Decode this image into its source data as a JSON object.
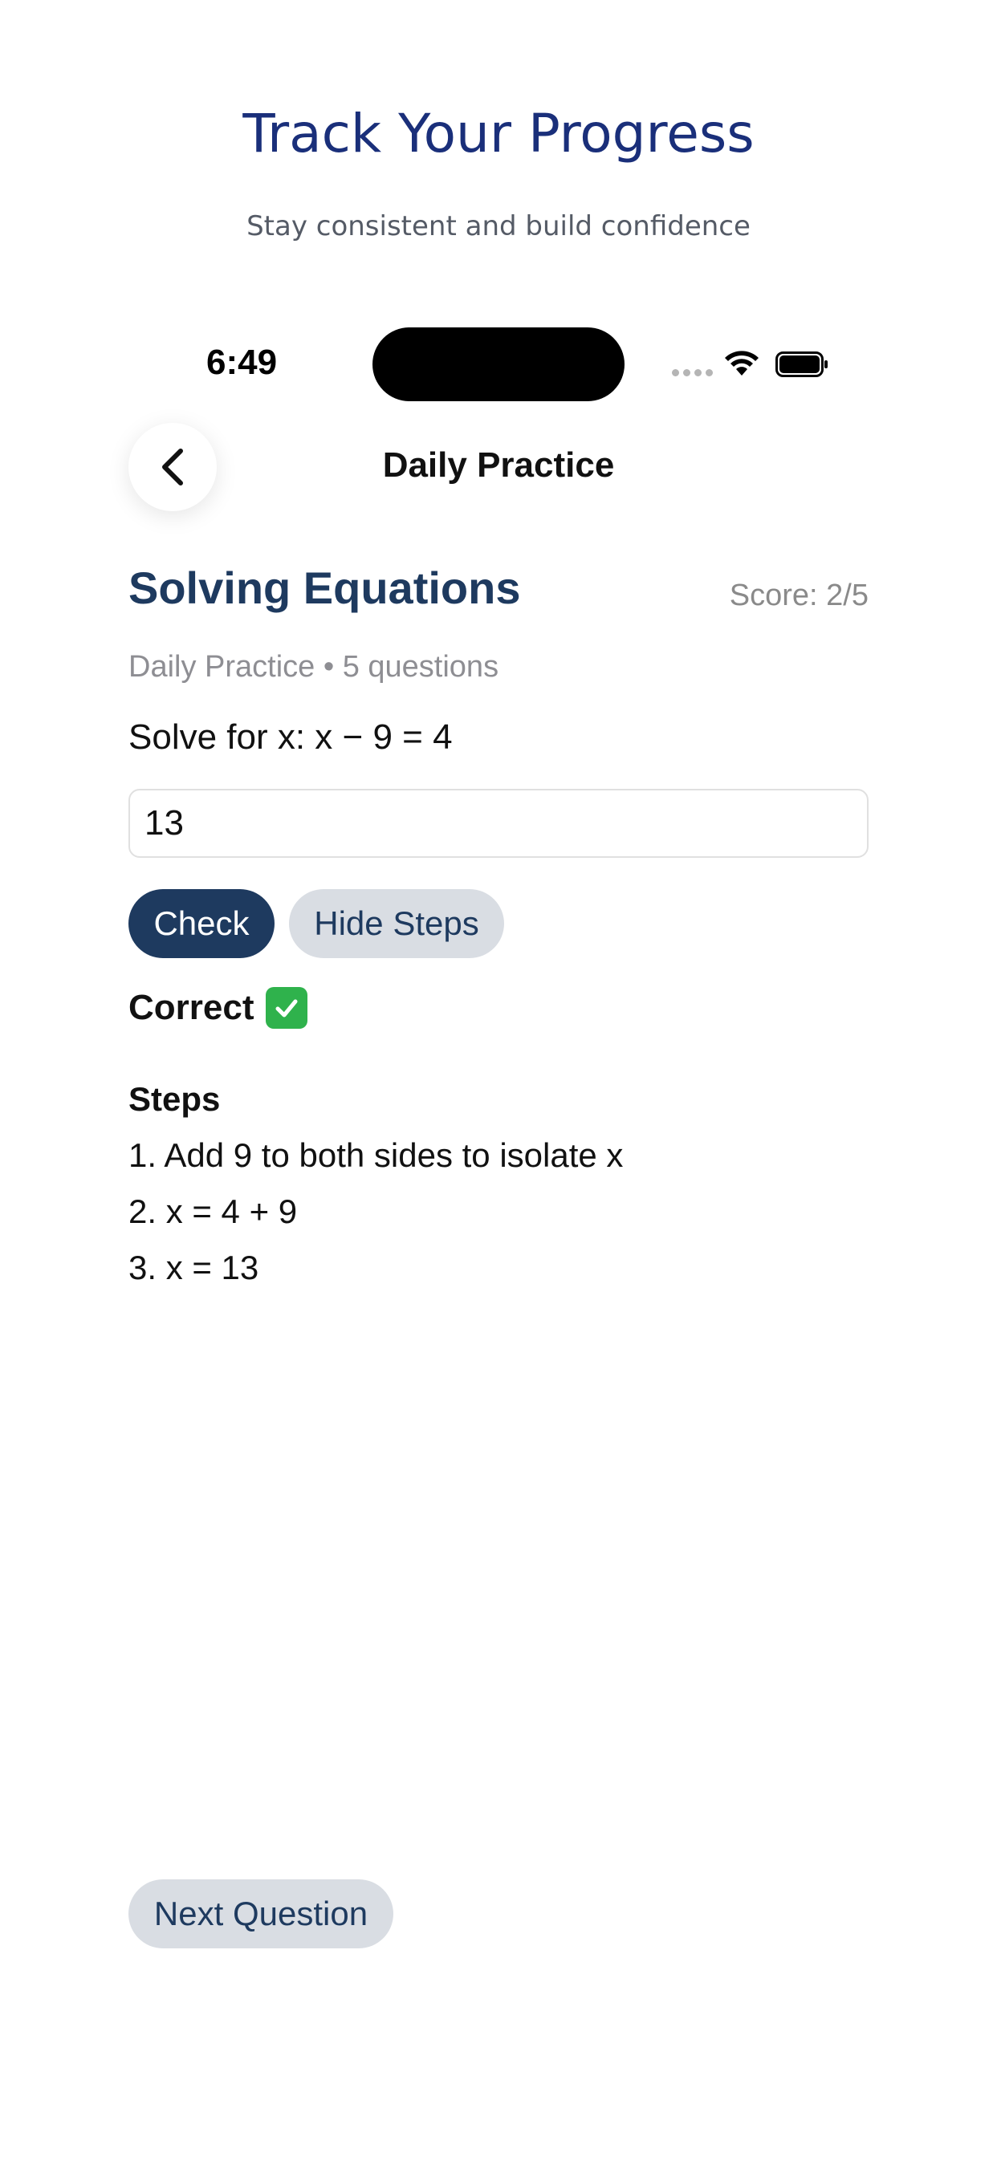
{
  "promo": {
    "title": "Track Your Progress",
    "subtitle": "Stay consistent and build confidence"
  },
  "status_bar": {
    "time": "6:49",
    "icons": [
      "signal-dots-icon",
      "wifi-icon",
      "battery-icon"
    ]
  },
  "nav": {
    "back_icon": "chevron-left-icon",
    "title": "Daily Practice"
  },
  "lesson": {
    "title": "Solving Equations",
    "score": "Score: 2/5",
    "meta": "Daily Practice • 5 questions"
  },
  "question": {
    "prompt": "Solve for x: x − 9 = 4",
    "answer_value": "13"
  },
  "actions": {
    "check_label": "Check",
    "hide_steps_label": "Hide Steps",
    "next_label": "Next Question"
  },
  "result": {
    "text": "Correct",
    "icon": "check-mark-icon",
    "status_color": "#2fb24c"
  },
  "steps": {
    "heading": "Steps",
    "items": [
      "1. Add 9 to both sides to isolate x",
      "2. x = 4 + 9",
      "3. x = 13"
    ]
  },
  "colors": {
    "primary": "#1e3a5f",
    "secondary_button": "#d9dde3",
    "promo_title": "#1a2f7a"
  }
}
